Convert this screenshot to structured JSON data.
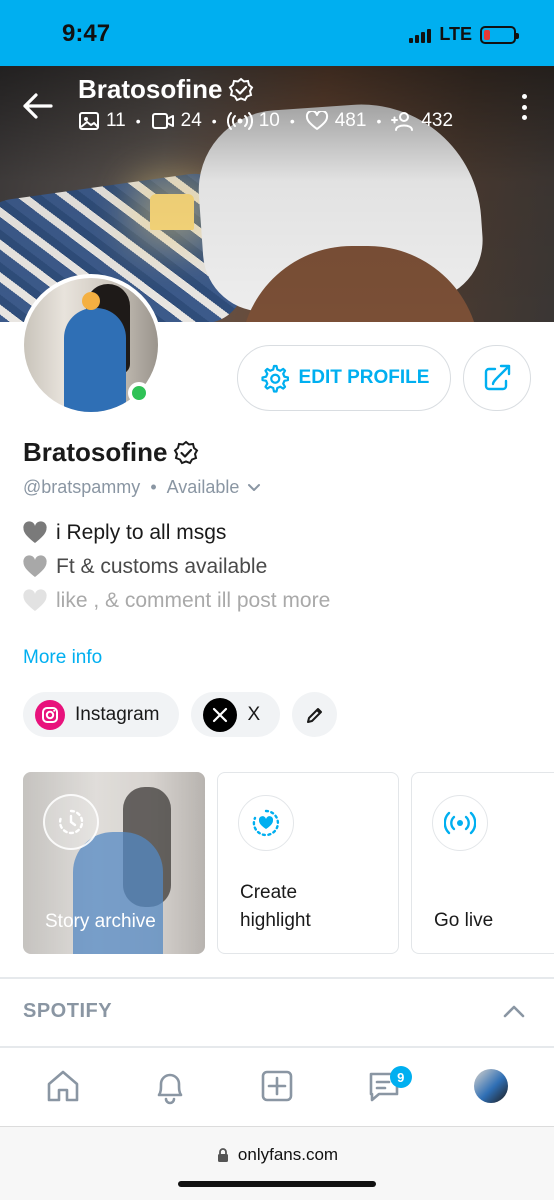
{
  "status_bar": {
    "time": "9:47",
    "network": "LTE",
    "battery_color": "#e53935"
  },
  "cover": {
    "name": "Bratosofine",
    "stats": {
      "photos": "11",
      "videos": "24",
      "streams": "10",
      "likes": "481",
      "fans": "432"
    }
  },
  "profile": {
    "name": "Bratosofine",
    "username": "@bratspammy",
    "availability": "Available",
    "bio": [
      "i Reply to all msgs",
      "Ft & customs available",
      "like , & comment ill post more"
    ],
    "more_info": "More info",
    "edit_label": "EDIT PROFILE",
    "online": true
  },
  "socials": [
    {
      "icon": "instagram-icon",
      "label": "Instagram"
    },
    {
      "icon": "x-icon",
      "label": "X"
    }
  ],
  "highlights": {
    "archive": "Story archive",
    "create": "Create highlight",
    "live": "Go live"
  },
  "sections": {
    "spotify": "SPOTIFY"
  },
  "nav": {
    "messages_badge": "9"
  },
  "browser": {
    "url": "onlyfans.com"
  },
  "colors": {
    "accent": "#00aff0",
    "online": "#2fc256",
    "instagram": "#e8127c"
  }
}
